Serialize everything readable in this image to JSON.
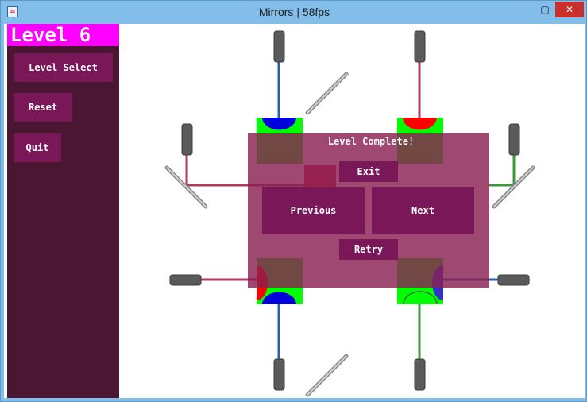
{
  "window": {
    "title": "Mirrors | 58fps",
    "app_icon_glyph": "≋"
  },
  "titlebar_controls": {
    "minimize_glyph": "–",
    "maximize_glyph": "▢",
    "close_glyph": "✕"
  },
  "sidebar": {
    "level_label": "Level 6",
    "buttons": {
      "level_select": "Level Select",
      "reset": "Reset",
      "quit": "Quit"
    }
  },
  "dialog": {
    "title": "Level Complete!",
    "buttons": {
      "exit": "Exit",
      "previous": "Previous",
      "next": "Next",
      "retry": "Retry"
    }
  },
  "colors": {
    "sidebar_bg": "#4b1632",
    "button_bg": "#7a1758",
    "level_header_bg": "#ff00ff",
    "target_tile_green": "#00ff00",
    "beam_blue": "#2f5fa8",
    "beam_red": "#b23a5a",
    "beam_green": "#3c9a3c",
    "emitter_gray": "#5a5a5a",
    "mirror_gray": "#9a9a9a"
  },
  "game_objects": {
    "emitters": [
      "emitter-top-left",
      "emitter-top-right",
      "emitter-left-upper",
      "emitter-right-upper",
      "emitter-left-lower",
      "emitter-right-lower",
      "emitter-bottom-left",
      "emitter-bottom-right"
    ],
    "mirrors": [
      "mirror-top",
      "mirror-left",
      "mirror-right",
      "mirror-bottom"
    ],
    "targets": [
      {
        "id": "target-top-left",
        "color": "blue"
      },
      {
        "id": "target-top-right",
        "color": "red"
      },
      {
        "id": "target-bottom-left",
        "color": "blue"
      },
      {
        "id": "target-bottom-right",
        "color": "green"
      }
    ]
  }
}
